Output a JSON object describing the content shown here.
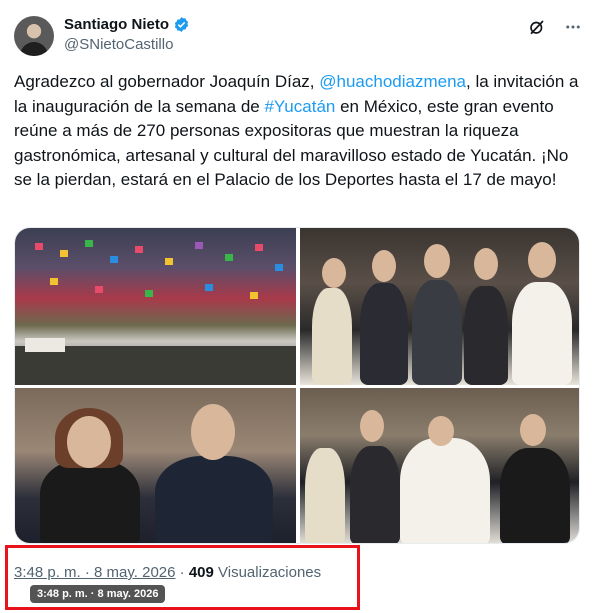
{
  "author": {
    "display_name": "Santiago Nieto",
    "handle": "@SNietoCastillo"
  },
  "icons": {
    "verified": "verified-badge-icon",
    "grok": "grok-icon",
    "more": "more-icon"
  },
  "tweet": {
    "t1": "Agradezco al gobernador Joaquín Díaz, ",
    "mention": "@huachodiazmena",
    "t2": ", la invitación a la inauguración de la semana de ",
    "hashtag": "#Yucatán",
    "t3": " en México, este gran evento reúne a más de 270 personas expositoras que muestran la riqueza gastronómica, artesanal y cultural del maravilloso estado de Yucatán. ¡No se la pierdan, estará en el Palacio de los Deportes hasta el 17 de mayo!"
  },
  "footer": {
    "time": "3:48 p. m. · 8 may. 2026",
    "separator": " · ",
    "views_count": "409",
    "views_label": " Visualizaciones",
    "tooltip": "3:48 p. m. · 8 may. 2026"
  },
  "colors": {
    "link": "#1d9bf0",
    "highlight": "#e8131b"
  }
}
